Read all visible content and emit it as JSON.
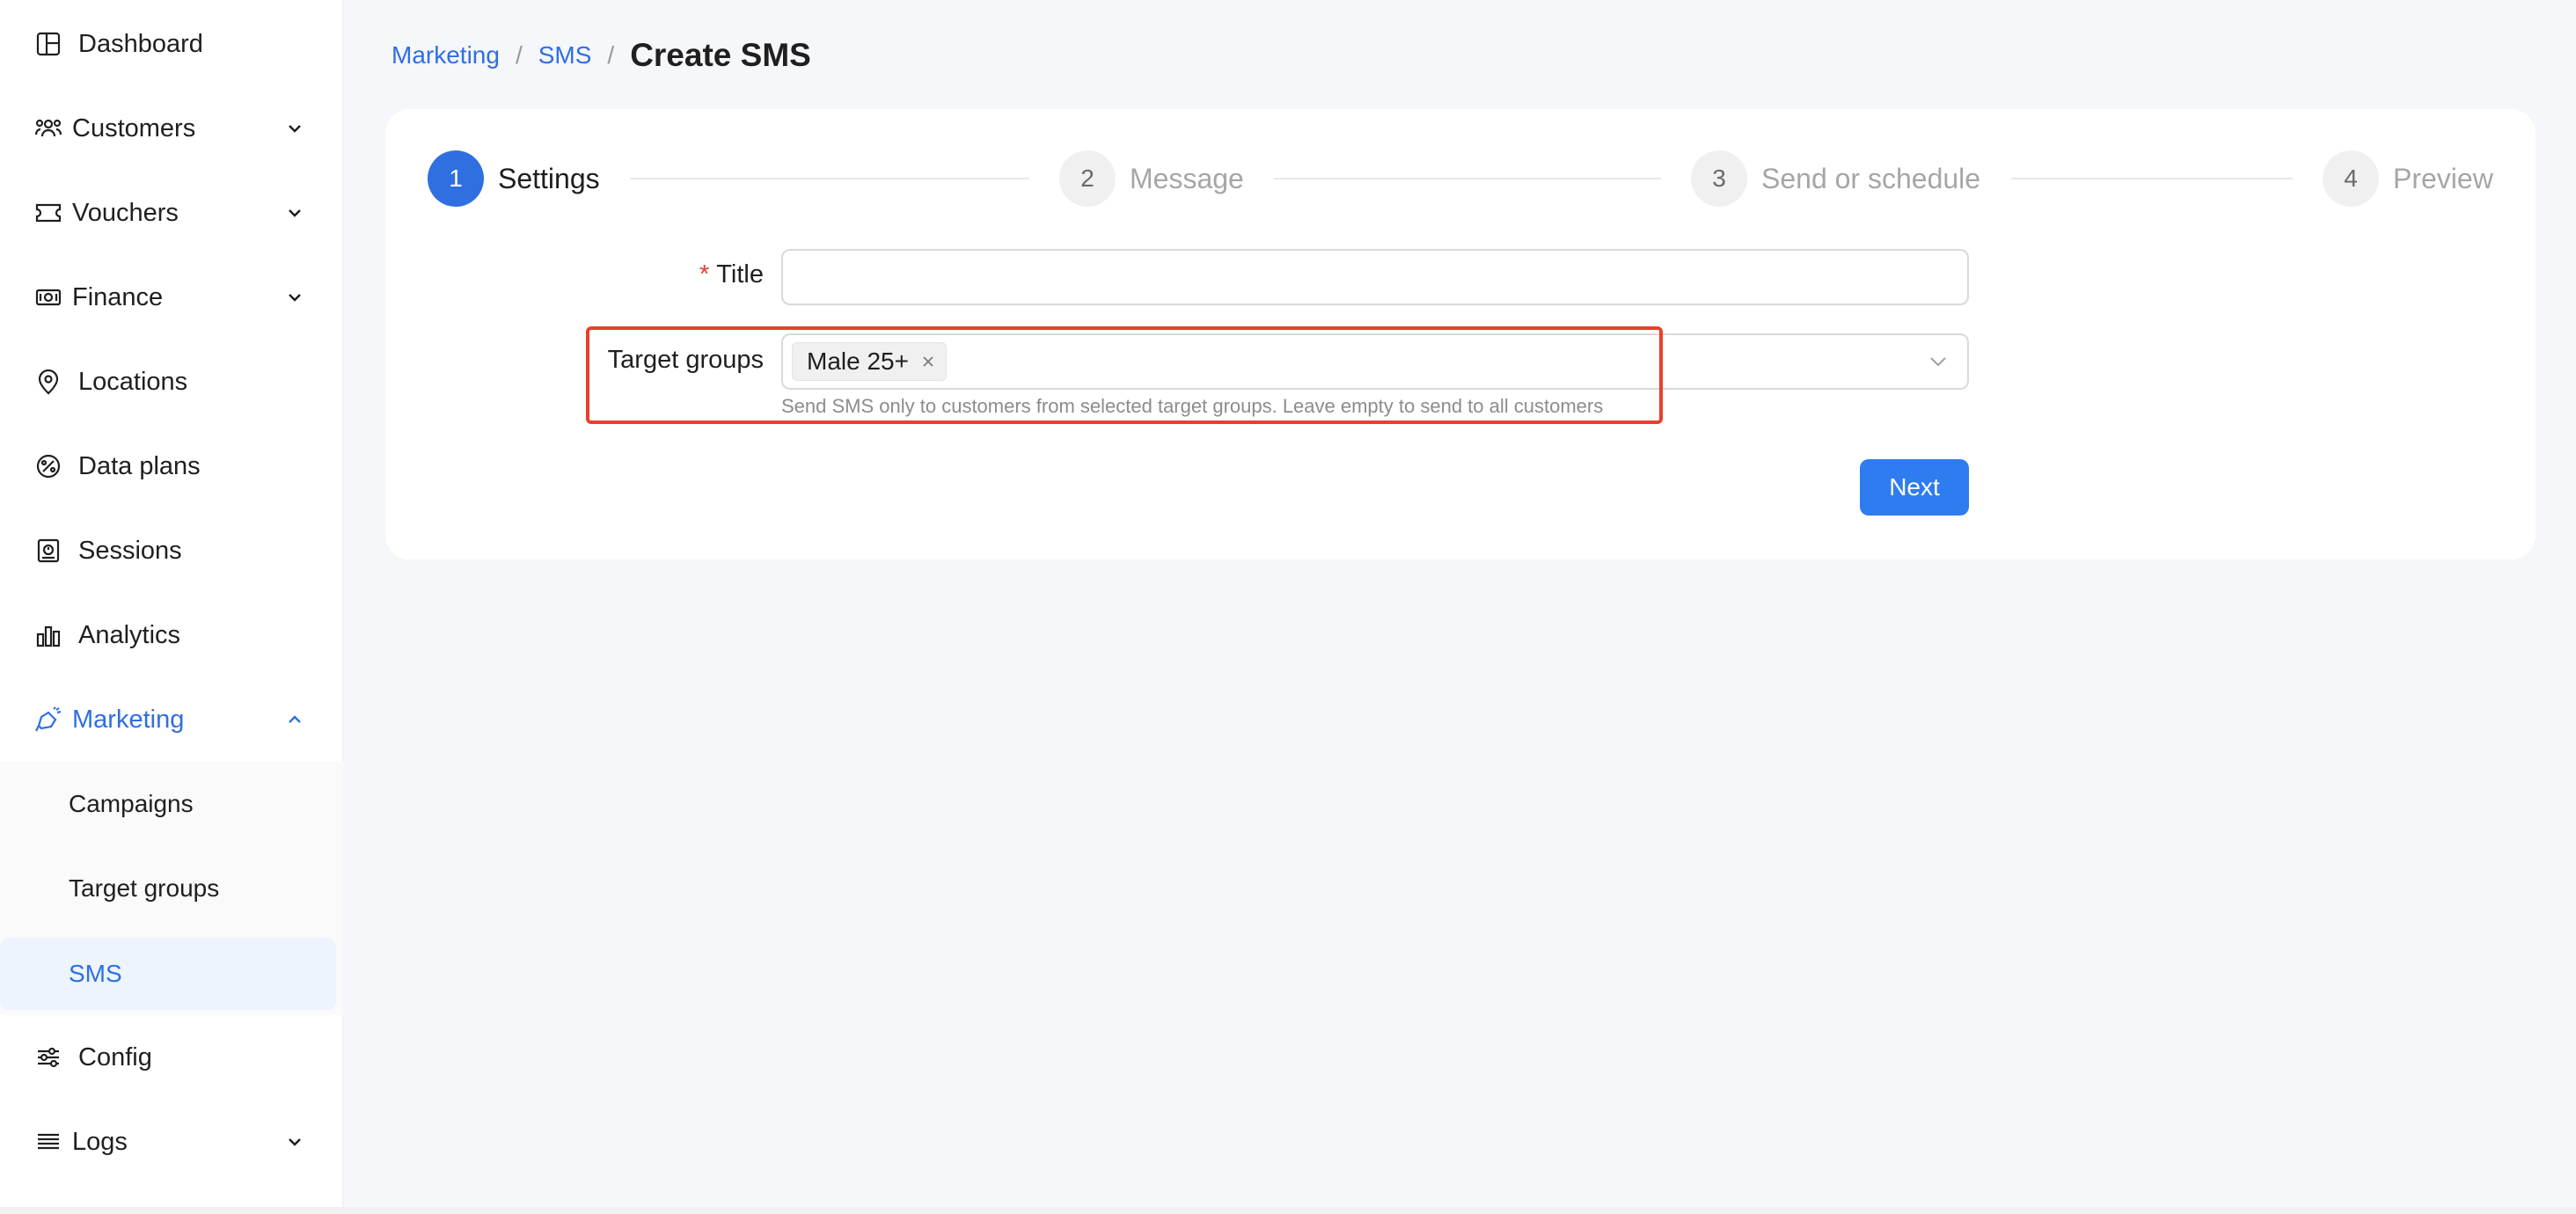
{
  "sidebar": {
    "items": [
      {
        "label": "Dashboard",
        "icon": "dashboard-icon"
      },
      {
        "label": "Customers",
        "icon": "customers-icon",
        "expandable": true
      },
      {
        "label": "Vouchers",
        "icon": "voucher-icon",
        "expandable": true
      },
      {
        "label": "Finance",
        "icon": "finance-icon",
        "expandable": true
      },
      {
        "label": "Locations",
        "icon": "location-pin-icon"
      },
      {
        "label": "Data plans",
        "icon": "data-plans-icon"
      },
      {
        "label": "Sessions",
        "icon": "sessions-icon"
      },
      {
        "label": "Analytics",
        "icon": "analytics-icon"
      },
      {
        "label": "Marketing",
        "icon": "marketing-icon",
        "expandable": true,
        "expanded": true,
        "active": true
      },
      {
        "label": "Config",
        "icon": "config-sliders-icon"
      },
      {
        "label": "Logs",
        "icon": "logs-icon",
        "expandable": true
      }
    ],
    "marketing_submenu": [
      {
        "label": "Campaigns"
      },
      {
        "label": "Target groups"
      },
      {
        "label": "SMS",
        "selected": true
      }
    ]
  },
  "breadcrumb": {
    "items": [
      "Marketing",
      "SMS"
    ],
    "separator": "/",
    "current": "Create SMS"
  },
  "steps": [
    {
      "number": "1",
      "label": "Settings",
      "active": true
    },
    {
      "number": "2",
      "label": "Message"
    },
    {
      "number": "3",
      "label": "Send or schedule"
    },
    {
      "number": "4",
      "label": "Preview"
    }
  ],
  "form": {
    "title_label": "Title",
    "title_required_mark": "*",
    "title_value": "",
    "target_groups_label": "Target groups",
    "target_groups_selected": [
      "Male 25+"
    ],
    "target_groups_help": "Send SMS only to customers from selected target groups. Leave empty to send to all customers",
    "next_label": "Next"
  },
  "colors": {
    "accent": "#2f6fe0",
    "button": "#2f7bf0",
    "highlight": "#e8402c",
    "required": "#e33d2f"
  }
}
